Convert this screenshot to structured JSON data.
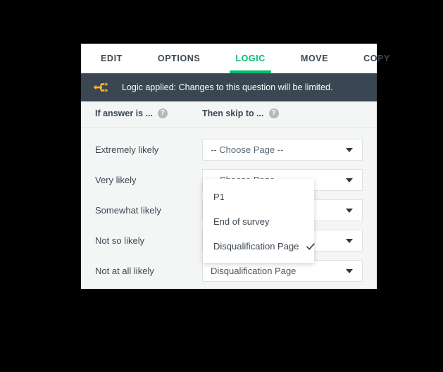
{
  "window": {
    "background_color": "#000000",
    "panel_background": "#f4f5f5"
  },
  "tabs": [
    {
      "label": "EDIT",
      "active": false
    },
    {
      "label": "OPTIONS",
      "active": false
    },
    {
      "label": "LOGIC",
      "active": true
    },
    {
      "label": "MOVE",
      "active": false
    },
    {
      "label": "COPY",
      "active": false
    }
  ],
  "tab_accent_color": "#00bf6f",
  "banner": {
    "icon": "logic-branch-icon",
    "icon_color": "#f5b324",
    "background_color": "#3a4651",
    "text": "Logic applied: Changes to this question will be limited."
  },
  "columns": {
    "left": {
      "label": "If answer is ...",
      "help_icon": "help-circle-icon",
      "help_glyph": "?"
    },
    "right": {
      "label": "Then skip to ...",
      "help_icon": "help-circle-icon",
      "help_glyph": "?"
    }
  },
  "rows": [
    {
      "answer": "Extremely likely",
      "selected": "-- Choose Page --",
      "is_placeholder": true
    },
    {
      "answer": "Very likely",
      "selected": "-- Choose Page --",
      "is_placeholder": true
    },
    {
      "answer": "Somewhat likely",
      "selected": "",
      "is_placeholder": true
    },
    {
      "answer": "Not so likely",
      "selected": "",
      "is_placeholder": true
    },
    {
      "answer": "Not at all likely",
      "selected": "Disqualification Page",
      "is_placeholder": false
    }
  ],
  "open_dropdown": {
    "owner_row_index": 1,
    "options": [
      {
        "label": "P1",
        "checked": false
      },
      {
        "label": "End of survey",
        "checked": false
      },
      {
        "label": "Disqualification Page",
        "checked": true
      }
    ],
    "check_glyph": "✓"
  }
}
